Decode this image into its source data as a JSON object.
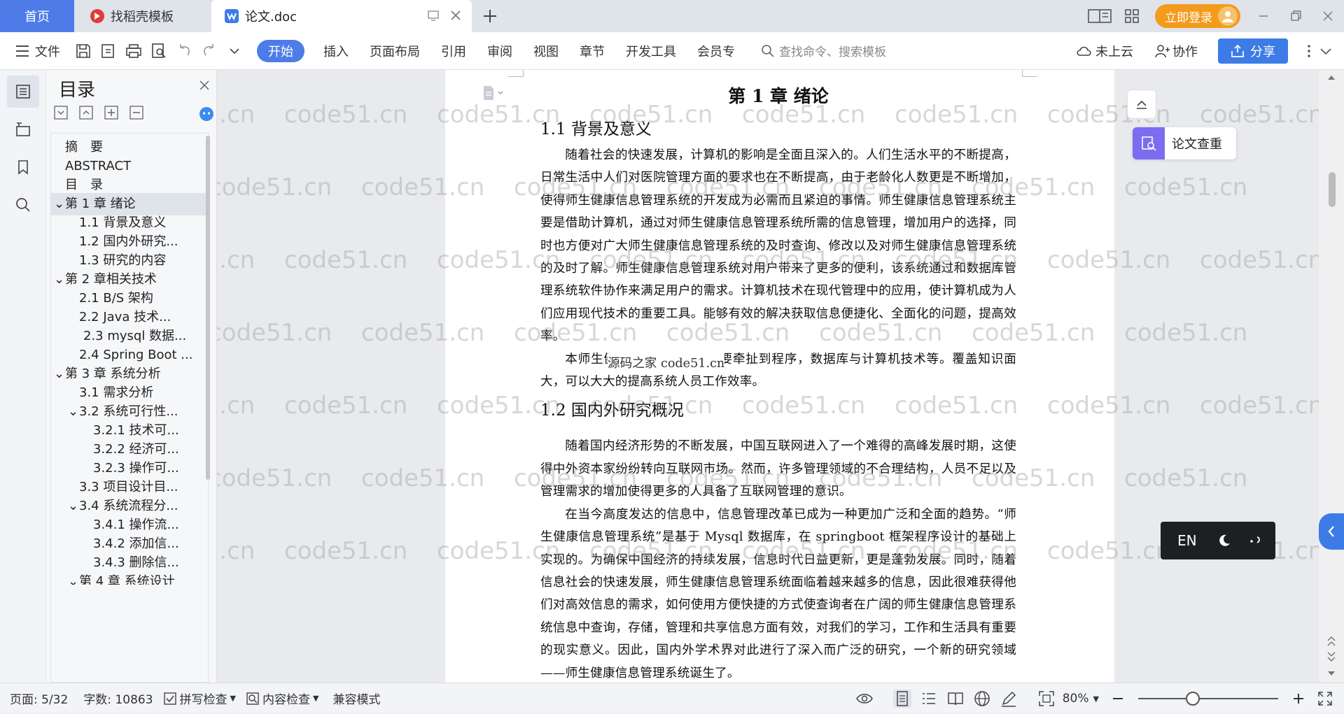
{
  "titlebar": {
    "tabs": [
      {
        "label": "首页"
      },
      {
        "label": "找稻壳模板"
      },
      {
        "label": "论文.doc"
      }
    ],
    "login_label": "立即登录"
  },
  "ribbon": {
    "menu_label": "文件",
    "items": [
      "开始",
      "插入",
      "页面布局",
      "引用",
      "审阅",
      "视图",
      "章节",
      "开发工具",
      "会员专"
    ],
    "search_placeholder": "查找命令、搜索模板",
    "cloud_label": "未上云",
    "collab_label": "协作",
    "share_label": "分享"
  },
  "toc": {
    "title": "目录",
    "items": [
      {
        "label": "摘　要",
        "level": 1
      },
      {
        "label": "ABSTRACT",
        "level": 1
      },
      {
        "label": "目　录",
        "level": 1
      },
      {
        "label": "第 1 章  绪论",
        "level": 1,
        "expanded": true,
        "selected": true
      },
      {
        "label": "1.1 背景及意义",
        "level": 2
      },
      {
        "label": "1.2  国内外研究...",
        "level": 2
      },
      {
        "label": "1.3  研究的内容",
        "level": 2
      },
      {
        "label": "第 2 章相关技术",
        "level": 1,
        "expanded": true
      },
      {
        "label": "2.1    B/S 架构",
        "level": 2
      },
      {
        "label": "2.2    Java 技术...",
        "level": 2
      },
      {
        "label": "2.3 mysql 数据...",
        "level": 2
      },
      {
        "label": "2.4 Spring Boot ...",
        "level": 2
      },
      {
        "label": "第 3 章  系统分析",
        "level": 1,
        "expanded": true
      },
      {
        "label": "3.1  需求分析",
        "level": 2
      },
      {
        "label": "3.2  系统可行性...",
        "level": 2,
        "expanded": true
      },
      {
        "label": "3.2.1 技术可...",
        "level": 3
      },
      {
        "label": "3.2.2 经济可...",
        "level": 3
      },
      {
        "label": "3.2.3 操作可...",
        "level": 3
      },
      {
        "label": "3.3  项目设计目...",
        "level": 2
      },
      {
        "label": "3.4 系统流程分...",
        "level": 2,
        "expanded": true
      },
      {
        "label": "3.4.1 操作流...",
        "level": 3
      },
      {
        "label": "3.4.2 添加信...",
        "level": 3
      },
      {
        "label": "3.4.3 删除信...",
        "level": 3
      },
      {
        "label": "第 4 章  系统设计",
        "level": 1
      }
    ]
  },
  "document": {
    "chapter_title": "第 1 章  绪论",
    "s1_title": "1.1 背景及意义",
    "p1": "随着社会的快速发展，计算机的影响是全面且深入的。人们生活水平的不断提高，日常生活中人们对医院管理方面的要求也在不断提高，由于老龄化人数更是不断增加，使得师生健康信息管理系统的开发成为必需而且紧迫的事情。师生健康信息管理系统主要是借助计算机，通过对师生健康信息管理系统所需的信息管理，增加用户的选择，同时也方便对广大师生健康信息管理系统的及时查询、修改以及对师生健康信息管理系统的及时了解。师生健康信息管理系统对用户带来了更多的便利，该系统通过和数据库管理系统软件协作来满足用户的需求。计算机技术在现代管理中的应用，使计算机成为人们应用现代技术的重要工具。能够有效的解决获取信息便捷化、全面化的问题，提高效率。",
    "p2": "本师生健康信息管理系统主要牵扯到程序，数据库与计算机技术等。覆盖知识面大，可以大大的提高系统人员工作效率。",
    "popup": "源码之家 code51.cn",
    "s2_title": "1.2  国内外研究概况",
    "p3": "随着国内经济形势的不断发展，中国互联网进入了一个难得的高峰发展时期，这使得中外资本家纷纷转向互联网市场。然而，许多管理领域的不合理结构，人员不足以及管理需求的增加使得更多的人具备了互联网管理的意识。",
    "p4": "在当今高度发达的信息中，信息管理改革已成为一种更加广泛和全面的趋势。“师生健康信息管理系统”是基于 Mysql 数据库，在 springboot 框架程序设计的基础上实现的。为确保中国经济的持续发展，信息时代日益更新，更是蓬勃发展。同时，随着信息社会的快速发展，师生健康信息管理系统面临着越来越多的信息，因此很难获得他们对高效信息的需求，如何使用方便快捷的方式使查询者在广阔的师生健康信息管理系统信息中查询，存储，管理和共享信息方面有效，对我们的学习，工作和生活具有重要的现实意义。因此，国内外学术界对此进行了深入而广泛的研究，一个新的研究领域——师生健康信息管理系统诞生了。",
    "watermark": "code51.cn"
  },
  "right_panel": {
    "check_label": "论文查重",
    "ime_label": "EN"
  },
  "status": {
    "page": "页面: 5/32",
    "words": "字数: 10863",
    "spell": "拼写检查",
    "content_check": "内容检查",
    "compat": "兼容模式",
    "zoom": "80%",
    "zoom_fraction": 0.38
  },
  "colors": {
    "accent": "#4d7ce8",
    "login": "#f39b1c",
    "check_icon": "#7b6cf0"
  }
}
